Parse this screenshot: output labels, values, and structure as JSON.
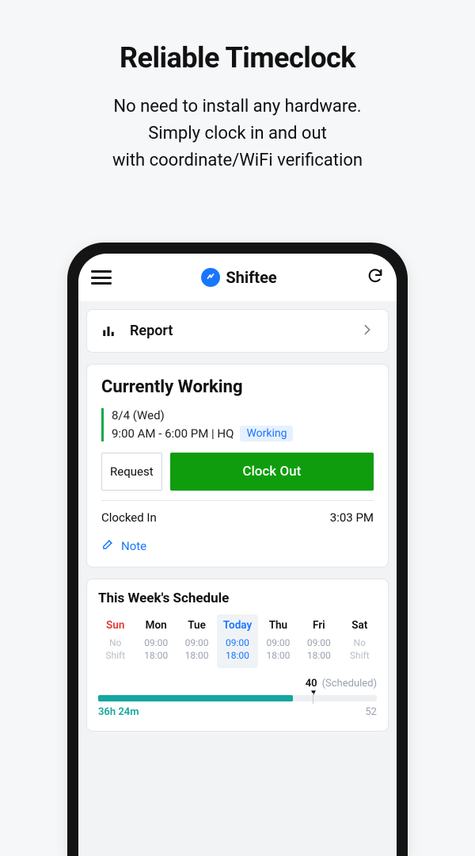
{
  "hero": {
    "title": "Reliable Timeclock",
    "sub1": "No need to install any hardware.",
    "sub2": "Simply clock in and out",
    "sub3": "with coordinate/WiFi verification"
  },
  "app": {
    "brand": "Shiftee",
    "report": {
      "label": "Report"
    },
    "status": {
      "title": "Currently Working",
      "date": "8/4 (Wed)",
      "time": "9:00 AM - 6:00 PM | HQ",
      "badge": "Working",
      "request_btn": "Request",
      "clockout_btn": "Clock Out",
      "clocked_label": "Clocked In",
      "clocked_time": "3:03 PM",
      "note_label": "Note"
    },
    "schedule": {
      "title": "This Week's Schedule",
      "days": [
        {
          "label": "Sun",
          "l1": "No",
          "l2": "Shift",
          "sun": true,
          "off": true
        },
        {
          "label": "Mon",
          "l1": "09:00",
          "l2": "18:00"
        },
        {
          "label": "Tue",
          "l1": "09:00",
          "l2": "18:00"
        },
        {
          "label": "Today",
          "l1": "09:00",
          "l2": "18:00",
          "today": true
        },
        {
          "label": "Thu",
          "l1": "09:00",
          "l2": "18:00"
        },
        {
          "label": "Fri",
          "l1": "09:00",
          "l2": "18:00"
        },
        {
          "label": "Sat",
          "l1": "No",
          "l2": "Shift",
          "off": true
        }
      ],
      "scheduled_num": "40",
      "scheduled_txt": "(Scheduled)",
      "worked": "36h 24m",
      "max": "52",
      "fill_pct": 70,
      "tick_pct": 77
    }
  }
}
